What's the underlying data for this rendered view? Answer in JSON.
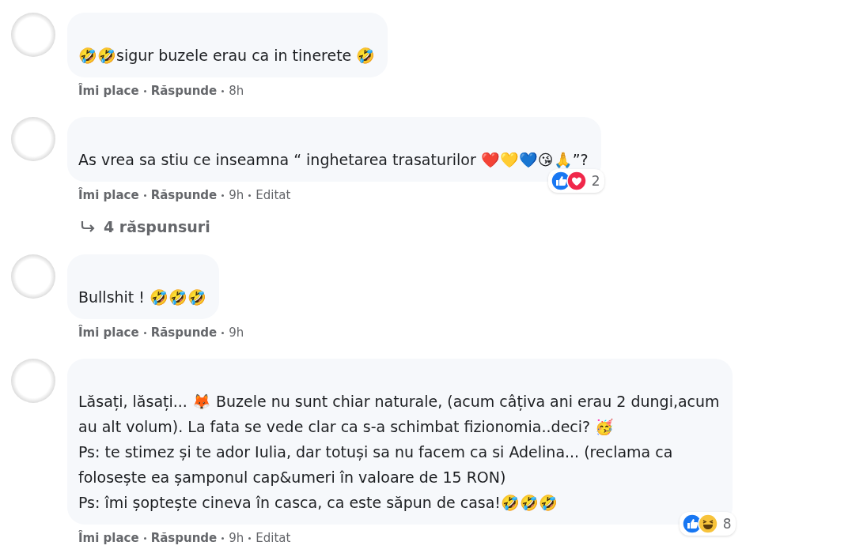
{
  "comments": [
    {
      "lines": [
        "🤣🤣sigur buzele erau ca in tinerete 🤣"
      ],
      "actions": [
        {
          "kind": "like",
          "label": "Îmi place"
        },
        {
          "kind": "reply",
          "label": "Răspunde"
        },
        {
          "kind": "time",
          "label": "8h"
        }
      ]
    },
    {
      "lines": [
        "As vrea sa stiu ce inseamna “ inghetarea trasaturilor ❤️💛💙😘🙏”?"
      ],
      "reactions": {
        "types": [
          {
            "kind": "like"
          },
          {
            "kind": "love"
          }
        ],
        "count": "2"
      },
      "actions": [
        {
          "kind": "like",
          "label": "Îmi place"
        },
        {
          "kind": "reply",
          "label": "Răspunde"
        },
        {
          "kind": "time",
          "label": "9h"
        },
        {
          "kind": "edited",
          "label": "Editat"
        }
      ],
      "replies": "4 răspunsuri"
    },
    {
      "lines": [
        "Bullshit ! 🤣🤣🤣"
      ],
      "actions": [
        {
          "kind": "like",
          "label": "Îmi place"
        },
        {
          "kind": "reply",
          "label": "Răspunde"
        },
        {
          "kind": "time",
          "label": "9h"
        }
      ]
    },
    {
      "lines": [
        "Lăsați, lăsați... 🦊 Buzele nu sunt chiar naturale, (acum câțiva ani erau 2 dungi,acum",
        "au alt volum). La fata se vede clar ca s-a schimbat fizionomia..deci? 🥳",
        "Ps: te stimez și te ador Iulia, dar totuși sa nu facem ca si Adelina... (reclama ca",
        "folosește ea șamponul cap&umeri în valoare de 15 RON)",
        "Ps: îmi șoptește cineva în casca, ca este săpun de casa!🤣🤣🤣"
      ],
      "reactions": {
        "types": [
          {
            "kind": "like"
          },
          {
            "kind": "haha"
          }
        ],
        "count": "8"
      },
      "actions": [
        {
          "kind": "like",
          "label": "Îmi place"
        },
        {
          "kind": "reply",
          "label": "Răspunde"
        },
        {
          "kind": "time",
          "label": "9h"
        },
        {
          "kind": "edited",
          "label": "Editat"
        }
      ]
    }
  ]
}
